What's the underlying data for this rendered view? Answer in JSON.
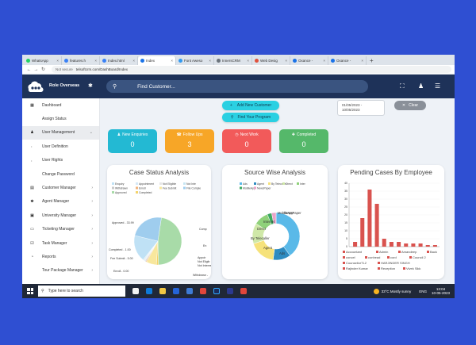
{
  "browser": {
    "tabs": [
      {
        "label": "WhatsApp",
        "color": "#25d366"
      },
      {
        "label": "features.h",
        "color": "#3b82f6"
      },
      {
        "label": "Index.html",
        "color": "#3b82f6"
      },
      {
        "label": "Index",
        "color": "#1a73e8",
        "active": true
      },
      {
        "label": "Font Aweso",
        "color": "#339af0"
      },
      {
        "label": "InnersCRM",
        "color": "#6c757d"
      },
      {
        "label": "Web Desig",
        "color": "#e0523e"
      },
      {
        "label": "Oxance -",
        "color": "#1a73e8"
      },
      {
        "label": "Oxance -",
        "color": "#1a73e8"
      }
    ],
    "new_tab": "+",
    "not_secure": "Not secure",
    "url": "telsoftcrm.com/DashBoard/Index"
  },
  "header": {
    "brand": "Role Overseas",
    "search_placeholder": "Find Customer...",
    "icons": [
      "expand-icon",
      "user-icon",
      "menu-icon"
    ]
  },
  "sidebar": {
    "items": [
      {
        "label": "Dashboard",
        "icon": "dashboard-icon",
        "type": "main"
      },
      {
        "label": "Assign Status",
        "type": "sub-plain"
      },
      {
        "label": "User Management",
        "icon": "user-icon",
        "type": "main",
        "chev": "⌄",
        "active": true
      },
      {
        "label": "User Definition",
        "type": "sub"
      },
      {
        "label": "User Rights",
        "type": "sub"
      },
      {
        "label": "Change Password",
        "type": "sub-plain"
      },
      {
        "label": "Customer Manager",
        "icon": "customer-icon",
        "type": "main",
        "chev": "›"
      },
      {
        "label": "Agent Manager",
        "icon": "agent-icon",
        "type": "main",
        "chev": "›"
      },
      {
        "label": "University Manager",
        "icon": "university-icon",
        "type": "main",
        "chev": "›"
      },
      {
        "label": "Ticketing Manager",
        "icon": "ticket-icon",
        "type": "main",
        "chev": "›"
      },
      {
        "label": "Task Manager",
        "icon": "task-icon",
        "type": "main",
        "chev": "›"
      },
      {
        "label": "Reports",
        "icon": "reports-icon",
        "type": "main",
        "chev": "›"
      },
      {
        "label": "Tour Package Manager",
        "type": "sub-plain",
        "chev": "›"
      }
    ]
  },
  "actions": {
    "add_customer": "Add New Customer",
    "find_program": "Find Your Program",
    "date_range": [
      "01/05/2023 -",
      "10/05/2023"
    ],
    "clear": "Clear"
  },
  "stats": [
    {
      "label": "New Enquiries",
      "value": "0",
      "color": "#23b9d3",
      "icon": "♟"
    },
    {
      "label": "Follow Ups",
      "value": "3",
      "color": "#f7a627",
      "icon": "☎"
    },
    {
      "label": "Next Work",
      "value": "0",
      "color": "#f25a5a",
      "icon": "◷"
    },
    {
      "label": "Completed",
      "value": "0",
      "color": "#55b86a",
      "icon": "✚"
    }
  ],
  "chart_data": [
    {
      "type": "pie",
      "title": "Case Status Analysis",
      "legend": [
        "Enquiry",
        "Appointment",
        "Not Eligible",
        "Not Inte",
        "Withdrawn",
        "Enroll",
        "Fee Submit",
        "File Comple",
        "Approved",
        "Completed"
      ],
      "slices": [
        {
          "label": "Approved",
          "value": 33.99,
          "color": "#a8dba8"
        },
        {
          "label": "Completed",
          "value": 1.0,
          "color": "#f3d36b"
        },
        {
          "label": "Fee Submit",
          "value": 5.0,
          "color": "#f8e79d"
        },
        {
          "label": "Enroll",
          "value": 0.0,
          "color": "#f0b27a"
        },
        {
          "label": "Withdrawn",
          "value": 0.0,
          "color": "#c8c8c8"
        },
        {
          "label": "Appoir",
          "value": 0.0,
          "color": "#d5e8f7"
        },
        {
          "label": "Not Eligib",
          "value": 0.0,
          "color": "#e6e6e6"
        },
        {
          "label": "Not Interest",
          "value": 0.0,
          "color": "#c8e6f2"
        },
        {
          "label": "En",
          "value": 13.0,
          "color": "#bfe1f5"
        },
        {
          "label": "Comp",
          "value": 17.0,
          "color": "#9fcdee"
        }
      ],
      "outer_labels": [
        "Approved - 33.99",
        "Comp",
        "En",
        "Completed - 1.00",
        "Fee Submit - 5.00",
        "Enroll - 0.00",
        "Appoir",
        "Not Eligib",
        "Not Interest",
        "Withdrawn -"
      ]
    },
    {
      "type": "pie",
      "title": "Source Wise Analysis",
      "legend": [
        "Ads",
        "Agent",
        "By Telecaller",
        "Direct",
        "Inter",
        "MobileApp",
        "NewsPaper"
      ],
      "slices": [
        {
          "label": "Ads",
          "value": 40,
          "color": "#5ab9e8"
        },
        {
          "label": "Agent",
          "value": 12,
          "color": "#2e8bc0"
        },
        {
          "label": "By Telecaller",
          "value": 18,
          "color": "#f6e27a"
        },
        {
          "label": "Direct",
          "value": 14,
          "color": "#cfe8a8"
        },
        {
          "label": "Internet",
          "value": 10,
          "color": "#8fd17a"
        },
        {
          "label": "MobileApp",
          "value": 3,
          "color": "#3da860"
        },
        {
          "label": "NewsPaper",
          "value": 3,
          "color": "#e9a3c8"
        }
      ]
    },
    {
      "type": "bar",
      "title": "Pending Cases By Employee",
      "ylim": [
        0,
        40
      ],
      "yticks": [
        0,
        5,
        10,
        15,
        20,
        25,
        30,
        35,
        40
      ],
      "values": [
        3,
        18,
        36,
        27,
        5,
        3,
        3,
        2,
        2,
        2,
        1,
        1
      ],
      "color": "#d9534f",
      "legend": [
        "Accountant",
        "Admin",
        "Amandeep",
        "Back",
        "concel",
        "conhead",
        "cord",
        "Council 2",
        "CounsellorTL2",
        "HARJINDER SINGH",
        "Rajinder Kumar",
        "Reception",
        "Vivek Sikk"
      ]
    }
  ],
  "taskbar": {
    "search_placeholder": "Type here to search",
    "weather": "33°C  Mostly sunny",
    "lang": "ENG",
    "time": "13:04",
    "date": "10-05-2023"
  }
}
